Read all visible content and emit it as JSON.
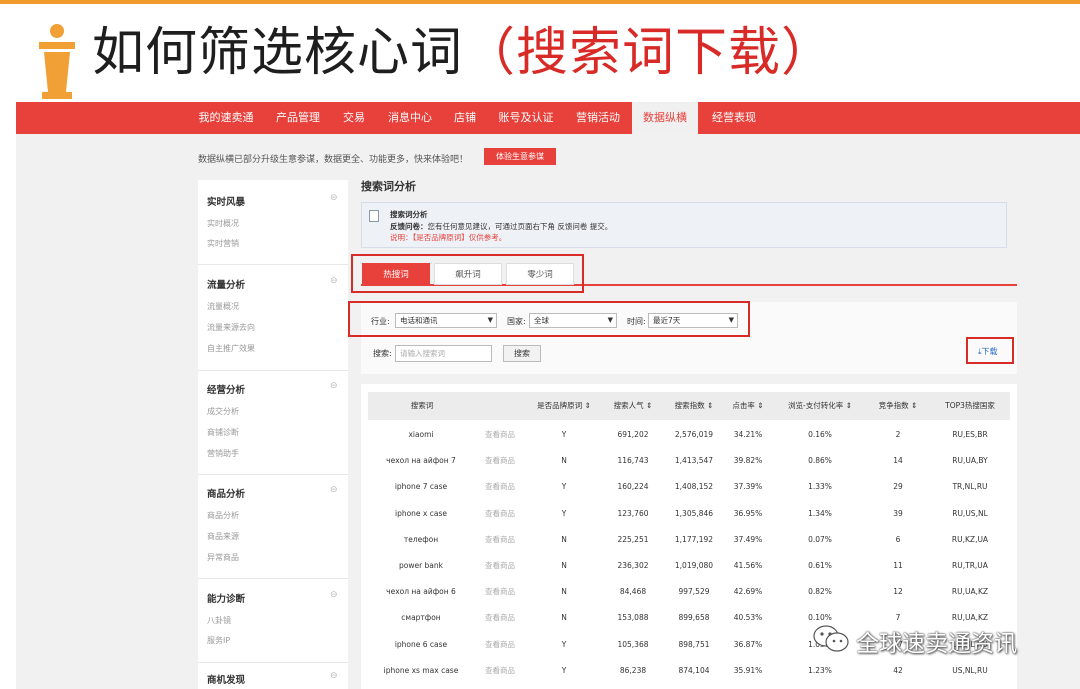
{
  "slide": {
    "title_main": "如何筛选核心词",
    "title_paren": "（搜索词下载）",
    "accent_color": "#d82a26"
  },
  "nav": {
    "items": [
      "我的速卖通",
      "产品管理",
      "交易",
      "消息中心",
      "店铺",
      "账号及认证",
      "营销活动",
      "数据纵横",
      "经营表现"
    ],
    "active_index": 7
  },
  "notice": {
    "text": "数据纵横已部分升级生意参谋，数据更全、功能更多，快来体验吧！",
    "button": "体验生意参谋"
  },
  "sidebar": {
    "groups": [
      {
        "title": "实时风暴",
        "items": [
          "实时概况",
          "实时营销"
        ]
      },
      {
        "title": "流量分析",
        "items": [
          "流量概况",
          "流量来源去向",
          "自主推广效果"
        ]
      },
      {
        "title": "经营分析",
        "items": [
          "成交分析",
          "商铺诊断",
          "营销助手"
        ]
      },
      {
        "title": "商品分析",
        "items": [
          "商品分析",
          "商品来源",
          "异常商品"
        ]
      },
      {
        "title": "能力诊断",
        "items": [
          "八卦镜",
          "服务IP"
        ]
      },
      {
        "title": "商机发现",
        "items": []
      }
    ],
    "toggle_icon": "collapse-icon"
  },
  "main": {
    "title": "搜索词分析",
    "tip": {
      "line1": "搜索词分析",
      "line2_label": "反馈问卷：",
      "line2": "您有任何意见建议，可通过页面右下角 反馈问卷 提交。",
      "line3": "说明：【是否品牌原词】仅供参考。"
    },
    "tabs": [
      "热搜词",
      "飙升词",
      "零少词"
    ],
    "active_tab": 0,
    "filters": {
      "industry_label": "行业:",
      "industry_value": "电话和通讯",
      "country_label": "国家:",
      "country_value": "全球",
      "time_label": "时间:",
      "time_value": "最近7天"
    },
    "search": {
      "label": "搜索:",
      "placeholder": "请输入搜索词",
      "button": "搜索"
    },
    "download": "下载",
    "highlight_color": "#d82a26"
  },
  "table": {
    "headers": [
      "搜索词",
      "是否品牌原词 ⇕",
      "搜索人气 ⇕",
      "搜索指数 ⇕",
      "点击率 ⇕",
      "浏览-支付转化率 ⇕",
      "竞争指数 ⇕",
      "TOP3热搜国家"
    ],
    "link_text": "查看商品",
    "rows": [
      [
        "xiaomi",
        "Y",
        "691,202",
        "2,576,019",
        "34.21%",
        "0.16%",
        "2",
        "RU,ES,BR"
      ],
      [
        "чехол на айфон 7",
        "N",
        "116,743",
        "1,413,547",
        "39.82%",
        "0.86%",
        "14",
        "RU,UA,BY"
      ],
      [
        "iphone 7 case",
        "Y",
        "160,224",
        "1,408,152",
        "37.39%",
        "1.33%",
        "29",
        "TR,NL,RU"
      ],
      [
        "iphone x case",
        "Y",
        "123,760",
        "1,305,846",
        "36.95%",
        "1.34%",
        "39",
        "RU,US,NL"
      ],
      [
        "телефон",
        "N",
        "225,251",
        "1,177,192",
        "37.49%",
        "0.07%",
        "6",
        "RU,KZ,UA"
      ],
      [
        "power bank",
        "N",
        "236,302",
        "1,019,080",
        "41.56%",
        "0.61%",
        "11",
        "RU,TR,UA"
      ],
      [
        "чехол на айфон 6",
        "N",
        "84,468",
        "997,529",
        "42.69%",
        "0.82%",
        "12",
        "RU,UA,KZ"
      ],
      [
        "смартфон",
        "N",
        "153,088",
        "899,658",
        "40.53%",
        "0.10%",
        "7",
        "RU,UA,KZ"
      ],
      [
        "iphone 6 case",
        "Y",
        "105,368",
        "898,751",
        "36.87%",
        "1.03%",
        "37",
        "US,NL,RU"
      ],
      [
        "iphone xs max case",
        "Y",
        "86,238",
        "874,104",
        "35.91%",
        "1.23%",
        "42",
        "US,NL,RU"
      ]
    ]
  },
  "watermark": {
    "text": "全球速卖通资讯",
    "icon": "wechat-icon"
  }
}
